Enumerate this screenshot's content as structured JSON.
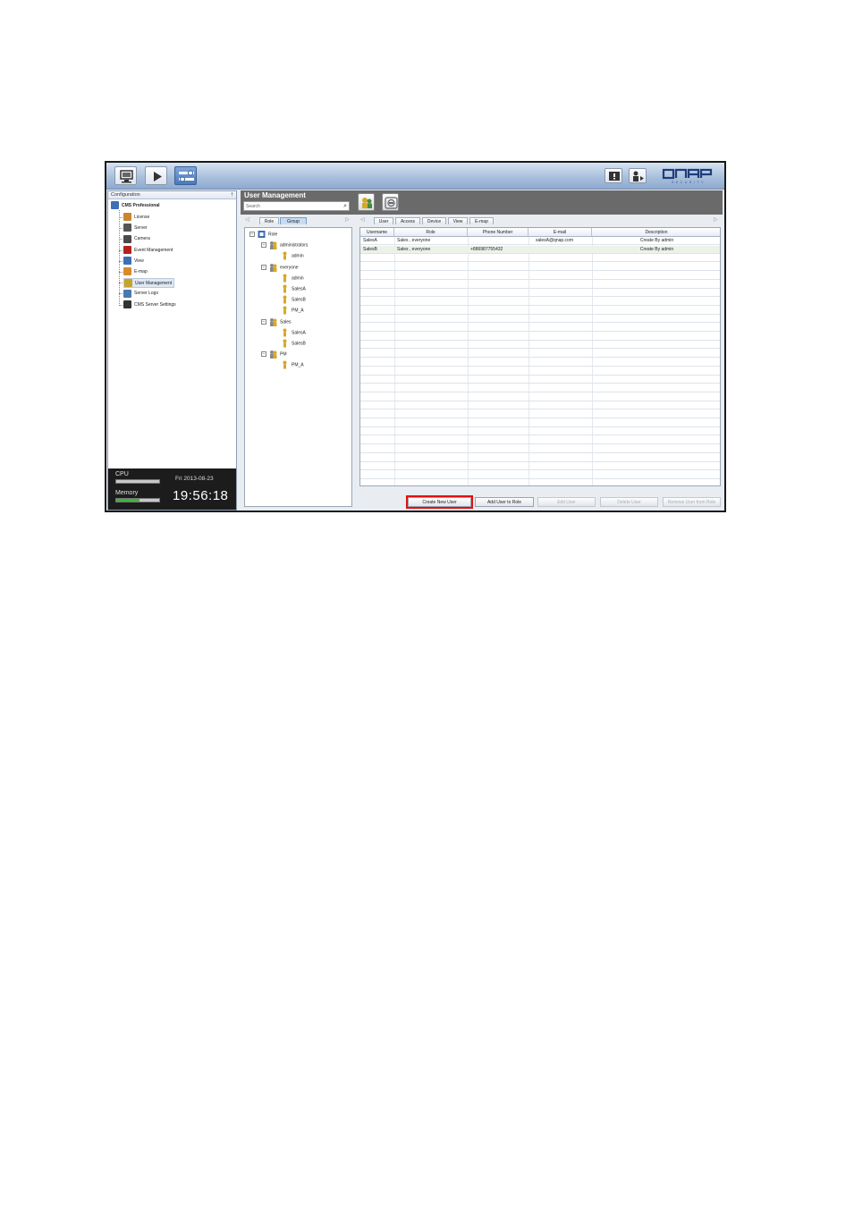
{
  "toolbar": {
    "buttons": [
      {
        "name": "monitor",
        "icon": "monitor-icon"
      },
      {
        "name": "playback",
        "icon": "play-icon"
      },
      {
        "name": "configuration",
        "icon": "config-icon"
      }
    ],
    "right_buttons": [
      {
        "name": "info",
        "icon": "info-icon"
      },
      {
        "name": "logout",
        "icon": "logout-icon"
      }
    ],
    "logo_text": "QNAP",
    "logo_sub": "SECURITY"
  },
  "left_panel": {
    "header": "Configuration",
    "pin": "†",
    "root": "CMS Professional",
    "items": [
      {
        "label": "License",
        "icon": "license-icon",
        "color": "#c8862e"
      },
      {
        "label": "Server",
        "icon": "server-icon",
        "color": "#555555"
      },
      {
        "label": "Camera",
        "icon": "camera-icon",
        "color": "#4a4a4a"
      },
      {
        "label": "Event Management",
        "icon": "event-icon",
        "color": "#b22222"
      },
      {
        "label": "View",
        "icon": "view-icon",
        "color": "#3d6fb5"
      },
      {
        "label": "E-map",
        "icon": "emap-icon",
        "color": "#d98a2b"
      },
      {
        "label": "User Management",
        "icon": "user-management-icon",
        "color": "#c9a227"
      },
      {
        "label": "Server Logs",
        "icon": "logs-icon",
        "color": "#4a78b0"
      },
      {
        "label": "CMS Server Settings",
        "icon": "settings-icon",
        "color": "#333333"
      }
    ],
    "selected_index": 6
  },
  "status": {
    "cpu_label": "CPU",
    "memory_label": "Memory",
    "cpu_level": 0.0,
    "memory_level": 0.55,
    "date": "Fri  2013-08-23",
    "clock": "19:56:18"
  },
  "main": {
    "title": "User Management",
    "search_placeholder": "Search",
    "tree_tabs": [
      "Role",
      "Group"
    ],
    "tree_tab_active": 0,
    "grid_tabs": [
      "User",
      "Access",
      "Device",
      "View",
      "E-map"
    ],
    "grid_tab_active": 0,
    "tree": [
      {
        "label": "Role",
        "level": 0,
        "toggle": "−",
        "icon": "role-icon"
      },
      {
        "label": "administrators",
        "level": 1,
        "toggle": "−",
        "icon": "group-icon"
      },
      {
        "label": "admin",
        "level": 2,
        "icon": "user-icon"
      },
      {
        "label": "everyone",
        "level": 1,
        "toggle": "−",
        "icon": "group-icon"
      },
      {
        "label": "admin",
        "level": 2,
        "icon": "user-icon"
      },
      {
        "label": "SalesA",
        "level": 2,
        "icon": "user-icon"
      },
      {
        "label": "SalesB",
        "level": 2,
        "icon": "user-icon"
      },
      {
        "label": "PM_A",
        "level": 2,
        "icon": "user-icon"
      },
      {
        "label": "Sales",
        "level": 1,
        "toggle": "−",
        "icon": "group-icon"
      },
      {
        "label": "SalesA",
        "level": 2,
        "icon": "user-icon"
      },
      {
        "label": "SalesB",
        "level": 2,
        "icon": "user-icon"
      },
      {
        "label": "PM",
        "level": 1,
        "toggle": "−",
        "icon": "group-icon"
      },
      {
        "label": "PM_A",
        "level": 2,
        "icon": "user-icon"
      }
    ],
    "table": {
      "columns": [
        "Username",
        "Role",
        "Phone Number",
        "E-mail",
        "Description"
      ],
      "rows": [
        [
          "SalesA",
          "Sales , everyone",
          "",
          "salesA@qnap.com",
          "Create By admin"
        ],
        [
          "SalesB",
          "Sales , everyone",
          "+886987755432",
          "",
          "Create By admin"
        ]
      ]
    },
    "actions": [
      {
        "label": "Create New User",
        "enabled": true
      },
      {
        "label": "Add User to Role",
        "enabled": true
      },
      {
        "label": "Edit User",
        "enabled": false
      },
      {
        "label": "Delete User",
        "enabled": false
      },
      {
        "label": "Remove User from Role",
        "enabled": false
      }
    ],
    "highlight_color": "#e01010"
  }
}
